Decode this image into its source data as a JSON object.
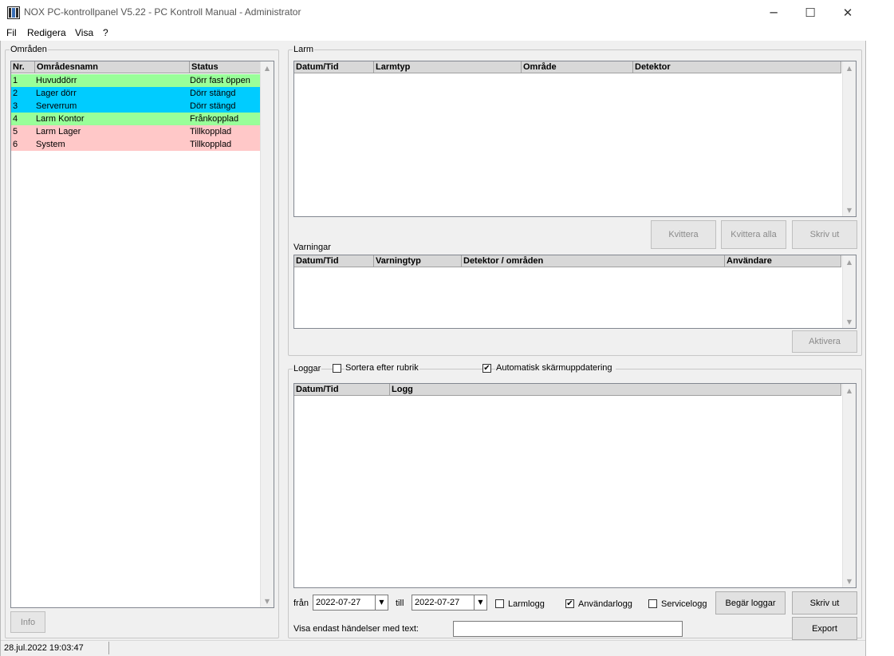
{
  "window": {
    "title": "NOX PC-kontrollpanel V5.22 - PC Kontroll Manual - Administrator",
    "minimize_glyph": "─",
    "maximize_glyph": "☐",
    "close_glyph": "✕"
  },
  "menu": {
    "items": [
      "Fil",
      "Redigera",
      "Visa",
      "?"
    ]
  },
  "areas": {
    "group_label": "Områden",
    "columns": [
      "Nr.",
      "Områdesnamn",
      "Status"
    ],
    "rows": [
      {
        "nr": "1",
        "name": "Huvuddörr",
        "status": "Dörr fast öppen",
        "color": "#99ff99"
      },
      {
        "nr": "2",
        "name": "Lager dörr",
        "status": "Dörr stängd",
        "color": "#00ccff"
      },
      {
        "nr": "3",
        "name": "Serverrum",
        "status": "Dörr stängd",
        "color": "#00ccff"
      },
      {
        "nr": "4",
        "name": "Larm Kontor",
        "status": "Frånkopplad",
        "color": "#99ff99"
      },
      {
        "nr": "5",
        "name": "Larm Lager",
        "status": "Tillkopplad",
        "color": "#ffc8c8"
      },
      {
        "nr": "6",
        "name": "System",
        "status": "Tillkopplad",
        "color": "#ffc8c8"
      }
    ],
    "info_button": "Info"
  },
  "alarms": {
    "group_label": "Larm",
    "columns": [
      "Datum/Tid",
      "Larmtyp",
      "Område",
      "Detektor"
    ],
    "buttons": {
      "acknowledge": "Kvittera",
      "acknowledge_all": "Kvittera alla",
      "print": "Skriv ut"
    }
  },
  "warnings": {
    "label": "Varningar",
    "columns": [
      "Datum/Tid",
      "Varningtyp",
      "Detektor / områden",
      "Användare"
    ],
    "activate_button": "Aktivera"
  },
  "logs": {
    "group_label": "Loggar",
    "sort_by_header_label": "Sortera efter rubrik",
    "sort_by_header_checked": false,
    "auto_refresh_label": "Automatisk skärmuppdatering",
    "auto_refresh_checked": true,
    "columns": [
      "Datum/Tid",
      "Logg"
    ],
    "from_label": "från",
    "from_date": "2022-07-27",
    "to_label": "till",
    "to_date": "2022-07-27",
    "alarm_log_label": "Larmlogg",
    "alarm_log_checked": false,
    "user_log_label": "Användarlogg",
    "user_log_checked": true,
    "service_log_label": "Servicelogg",
    "service_log_checked": false,
    "request_logs_button": "Begär loggar",
    "print_button": "Skriv ut",
    "filter_label": "Visa endast händelser med text:",
    "filter_value": "",
    "export_button": "Export"
  },
  "status_bar": {
    "datetime": "28.jul.2022  19:03:47"
  },
  "icons": {
    "checkmark": "✔",
    "scroll_up": "▲",
    "scroll_down": "▼",
    "dropdown": "▼"
  }
}
